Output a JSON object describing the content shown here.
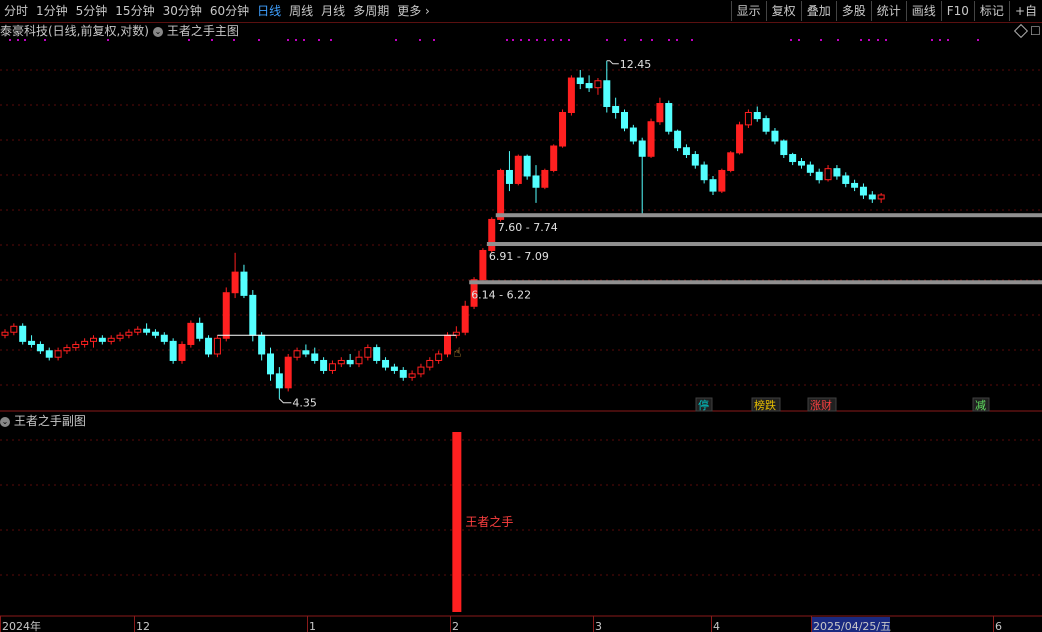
{
  "toolbar": {
    "periods": [
      {
        "label": "分时",
        "active": false
      },
      {
        "label": "1分钟",
        "active": false
      },
      {
        "label": "5分钟",
        "active": false
      },
      {
        "label": "15分钟",
        "active": false
      },
      {
        "label": "30分钟",
        "active": false
      },
      {
        "label": "60分钟",
        "active": false
      },
      {
        "label": "日线",
        "active": true
      },
      {
        "label": "周线",
        "active": false
      },
      {
        "label": "月线",
        "active": false
      },
      {
        "label": "多周期",
        "active": false
      },
      {
        "label": "更多",
        "active": false
      }
    ],
    "more_icon": "chevron-right-icon",
    "right_buttons": [
      "显示",
      "复权",
      "叠加",
      "多股",
      "统计",
      "画线",
      "F10",
      "标记",
      "+自"
    ]
  },
  "chart_header": {
    "stock_title": "泰豪科技(日线,前复权,对数)",
    "indicator": "王者之手主图"
  },
  "price_labels": {
    "high": "12.45",
    "low": "4.35",
    "zone1": "7.60 - 7.74",
    "zone2": "6.91 - 7.09",
    "zone3": "6.14 - 6.22"
  },
  "signal_tags": [
    {
      "text": "停",
      "color": "#00c8c8"
    },
    {
      "text": "榜跌",
      "color": "#e8c000"
    },
    {
      "text": "涨财",
      "color": "#ff4040"
    },
    {
      "text": "减",
      "color": "#60e060"
    }
  ],
  "sub_chart": {
    "title": "王者之手副图",
    "bar_label": "王者之手"
  },
  "date_axis": {
    "labels": [
      "2024年",
      "12",
      "1",
      "2",
      "3",
      "4",
      "2025/04/25/五",
      "6"
    ]
  },
  "colors": {
    "up": "#ff2020",
    "down": "#54ffff",
    "zone": "#909090",
    "magenta": "#c000c0"
  },
  "chart_data": {
    "type": "candlestick",
    "series": [
      {
        "name": "",
        "values": [
          [
            5.3,
            5.4,
            5.25,
            5.35
          ],
          [
            5.35,
            5.5,
            5.3,
            5.45
          ],
          [
            5.45,
            5.5,
            5.15,
            5.2
          ],
          [
            5.2,
            5.3,
            5.1,
            5.15
          ],
          [
            5.15,
            5.2,
            5.0,
            5.05
          ],
          [
            5.05,
            5.1,
            4.9,
            4.95
          ],
          [
            4.95,
            5.1,
            4.9,
            5.05
          ],
          [
            5.05,
            5.15,
            5.0,
            5.1
          ],
          [
            5.1,
            5.2,
            5.05,
            5.15
          ],
          [
            5.15,
            5.25,
            5.1,
            5.2
          ],
          [
            5.2,
            5.3,
            5.1,
            5.25
          ],
          [
            5.25,
            5.3,
            5.15,
            5.2
          ],
          [
            5.2,
            5.3,
            5.15,
            5.25
          ],
          [
            5.25,
            5.35,
            5.2,
            5.3
          ],
          [
            5.3,
            5.4,
            5.25,
            5.35
          ],
          [
            5.35,
            5.45,
            5.3,
            5.4
          ],
          [
            5.4,
            5.5,
            5.3,
            5.35
          ],
          [
            5.35,
            5.4,
            5.25,
            5.3
          ],
          [
            5.3,
            5.35,
            5.15,
            5.2
          ],
          [
            5.2,
            5.25,
            4.85,
            4.9
          ],
          [
            4.9,
            5.2,
            4.85,
            5.15
          ],
          [
            5.15,
            5.55,
            5.1,
            5.5
          ],
          [
            5.5,
            5.6,
            5.2,
            5.25
          ],
          [
            5.25,
            5.3,
            4.95,
            5.0
          ],
          [
            5.0,
            5.3,
            4.95,
            5.25
          ],
          [
            5.25,
            6.15,
            5.2,
            6.05
          ],
          [
            6.05,
            6.85,
            5.95,
            6.45
          ],
          [
            6.45,
            6.6,
            5.95,
            6.0
          ],
          [
            6.0,
            6.1,
            5.2,
            5.3
          ],
          [
            5.3,
            5.35,
            4.9,
            5.0
          ],
          [
            5.0,
            5.1,
            4.6,
            4.7
          ],
          [
            4.7,
            4.8,
            4.35,
            4.5
          ],
          [
            4.5,
            5.0,
            4.45,
            4.95
          ],
          [
            4.95,
            5.1,
            4.9,
            5.05
          ],
          [
            5.05,
            5.15,
            4.95,
            5.0
          ],
          [
            5.0,
            5.1,
            4.85,
            4.9
          ],
          [
            4.9,
            4.95,
            4.7,
            4.75
          ],
          [
            4.75,
            4.9,
            4.7,
            4.85
          ],
          [
            4.85,
            4.95,
            4.8,
            4.9
          ],
          [
            4.9,
            5.0,
            4.8,
            4.85
          ],
          [
            4.85,
            5.05,
            4.8,
            4.95
          ],
          [
            4.95,
            5.15,
            4.9,
            5.1
          ],
          [
            5.1,
            5.15,
            4.85,
            4.9
          ],
          [
            4.9,
            4.95,
            4.75,
            4.8
          ],
          [
            4.8,
            4.85,
            4.7,
            4.75
          ],
          [
            4.75,
            4.8,
            4.6,
            4.65
          ],
          [
            4.65,
            4.75,
            4.6,
            4.7
          ],
          [
            4.7,
            4.85,
            4.65,
            4.8
          ],
          [
            4.8,
            4.95,
            4.75,
            4.9
          ],
          [
            4.9,
            5.05,
            4.85,
            5.0
          ],
          [
            5.0,
            5.35,
            4.95,
            5.3
          ],
          [
            5.3,
            5.45,
            5.25,
            5.35
          ],
          [
            5.35,
            5.9,
            5.3,
            5.8
          ],
          [
            5.8,
            6.35,
            5.75,
            6.3
          ],
          [
            6.3,
            6.95,
            6.25,
            6.9
          ],
          [
            6.9,
            7.65,
            6.85,
            7.6
          ],
          [
            7.6,
            8.9,
            7.55,
            8.85
          ],
          [
            8.85,
            9.4,
            8.3,
            8.5
          ],
          [
            8.5,
            9.3,
            8.45,
            9.25
          ],
          [
            9.25,
            9.3,
            8.6,
            8.7
          ],
          [
            8.7,
            9.0,
            8.0,
            8.4
          ],
          [
            8.4,
            8.9,
            8.35,
            8.85
          ],
          [
            8.85,
            9.6,
            8.8,
            9.55
          ],
          [
            9.55,
            10.7,
            9.5,
            10.6
          ],
          [
            10.6,
            11.9,
            10.5,
            11.8
          ],
          [
            11.8,
            12.1,
            11.4,
            11.6
          ],
          [
            11.6,
            11.9,
            11.3,
            11.45
          ],
          [
            11.45,
            11.8,
            11.2,
            11.7
          ],
          [
            11.7,
            12.45,
            10.6,
            10.8
          ],
          [
            10.8,
            11.1,
            10.4,
            10.6
          ],
          [
            10.6,
            10.7,
            10.0,
            10.1
          ],
          [
            10.1,
            10.2,
            9.6,
            9.7
          ],
          [
            9.7,
            9.8,
            7.7,
            9.25
          ],
          [
            9.25,
            10.4,
            9.2,
            10.3
          ],
          [
            10.3,
            11.1,
            10.2,
            10.9
          ],
          [
            10.9,
            11.0,
            9.9,
            10.0
          ],
          [
            10.0,
            10.05,
            9.4,
            9.5
          ],
          [
            9.5,
            9.6,
            9.2,
            9.3
          ],
          [
            9.3,
            9.4,
            8.9,
            9.0
          ],
          [
            9.0,
            9.1,
            8.5,
            8.6
          ],
          [
            8.6,
            8.7,
            8.2,
            8.3
          ],
          [
            8.3,
            8.9,
            8.25,
            8.85
          ],
          [
            8.85,
            9.4,
            8.8,
            9.35
          ],
          [
            9.35,
            10.3,
            9.3,
            10.2
          ],
          [
            10.2,
            10.7,
            10.1,
            10.6
          ],
          [
            10.6,
            10.8,
            10.3,
            10.4
          ],
          [
            10.4,
            10.5,
            9.9,
            10.0
          ],
          [
            10.0,
            10.1,
            9.6,
            9.7
          ],
          [
            9.7,
            9.75,
            9.2,
            9.3
          ],
          [
            9.3,
            9.35,
            9.0,
            9.1
          ],
          [
            9.1,
            9.2,
            8.9,
            9.0
          ],
          [
            9.0,
            9.1,
            8.7,
            8.8
          ],
          [
            8.8,
            8.9,
            8.5,
            8.6
          ],
          [
            8.6,
            9.0,
            8.55,
            8.9
          ],
          [
            8.9,
            9.0,
            8.6,
            8.7
          ],
          [
            8.7,
            8.8,
            8.4,
            8.5
          ],
          [
            8.5,
            8.6,
            8.3,
            8.4
          ],
          [
            8.4,
            8.5,
            8.1,
            8.2
          ],
          [
            8.2,
            8.3,
            8.0,
            8.1
          ],
          [
            8.1,
            8.25,
            8.0,
            8.2
          ]
        ]
      }
    ],
    "price_levels": [
      6.25,
      7.04,
      7.7
    ],
    "ylim": [
      4.2,
      13.2
    ],
    "log_scale": true,
    "grid": true,
    "sub_chart_signal": {
      "bar_index": 51,
      "value": 1
    }
  }
}
